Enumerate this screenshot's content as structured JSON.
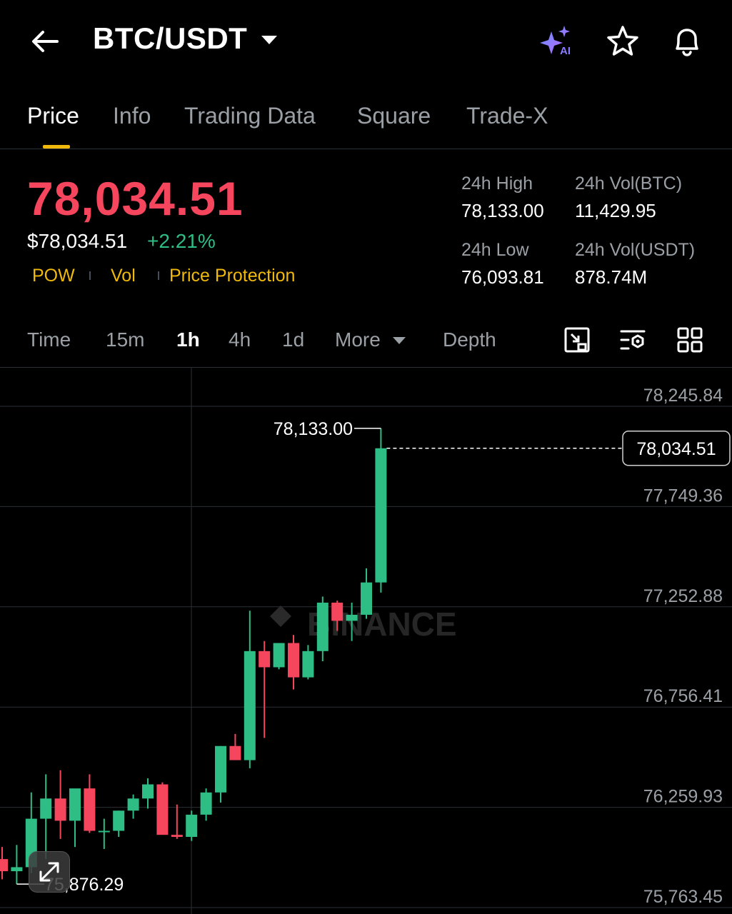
{
  "header": {
    "pair": "BTC/USDT",
    "icons": [
      "back-arrow-icon",
      "ai-sparkle-icon",
      "star-icon",
      "bell-icon"
    ],
    "ai_label": "AI"
  },
  "tabs": [
    {
      "label": "Price",
      "active": true
    },
    {
      "label": "Info"
    },
    {
      "label": "Trading Data"
    },
    {
      "label": "Square"
    },
    {
      "label": "Trade-X"
    }
  ],
  "price": {
    "last": "78,034.51",
    "usd": "$78,034.51",
    "change": "+2.21%",
    "tags": [
      "POW",
      "Vol",
      "Price Protection"
    ]
  },
  "stats": {
    "high_label": "24h High",
    "high_value": "78,133.00",
    "volbtc_label": "24h Vol(BTC)",
    "volbtc_value": "11,429.95",
    "low_label": "24h Low",
    "low_value": "76,093.81",
    "volusdt_label": "24h Vol(USDT)",
    "volusdt_value": "878.74M"
  },
  "intervals": {
    "items": [
      "Time",
      "15m",
      "1h",
      "4h",
      "1d",
      "More",
      "Depth"
    ],
    "active": "1h"
  },
  "chart_data": {
    "type": "candlestick",
    "watermark": "BINANCE",
    "y_ticks": [
      "78,245.84",
      "77,749.36",
      "77,252.88",
      "76,756.41",
      "76,259.93",
      "75,763.45"
    ],
    "y_tick_values": [
      78245.84,
      77749.36,
      77252.88,
      76756.41,
      76259.93,
      75763.45
    ],
    "ylim": [
      75763.45,
      78245.84
    ],
    "current_price": 78034.51,
    "current_label": "78,034.51",
    "high_marker": {
      "value": 78133.0,
      "label": "78,133.00"
    },
    "low_marker": {
      "value": 75876.29,
      "label": "75,876.29"
    },
    "candles": [
      {
        "o": 76000,
        "h": 76060,
        "l": 75900,
        "c": 75940
      },
      {
        "o": 75940,
        "h": 76070,
        "l": 75876.29,
        "c": 75960
      },
      {
        "o": 75960,
        "h": 76330,
        "l": 75930,
        "c": 76200
      },
      {
        "o": 76200,
        "h": 76420,
        "l": 76000,
        "c": 76300
      },
      {
        "o": 76300,
        "h": 76440,
        "l": 76100,
        "c": 76190
      },
      {
        "o": 76190,
        "h": 76340,
        "l": 76060,
        "c": 76350
      },
      {
        "o": 76350,
        "h": 76420,
        "l": 76130,
        "c": 76140
      },
      {
        "o": 76140,
        "h": 76200,
        "l": 76050,
        "c": 76140
      },
      {
        "o": 76140,
        "h": 76240,
        "l": 76110,
        "c": 76240
      },
      {
        "o": 76240,
        "h": 76320,
        "l": 76200,
        "c": 76300
      },
      {
        "o": 76300,
        "h": 76400,
        "l": 76250,
        "c": 76370
      },
      {
        "o": 76370,
        "h": 76380,
        "l": 76130,
        "c": 76120
      },
      {
        "o": 76120,
        "h": 76270,
        "l": 76100,
        "c": 76110
      },
      {
        "o": 76110,
        "h": 76240,
        "l": 76090,
        "c": 76220
      },
      {
        "o": 76220,
        "h": 76350,
        "l": 76190,
        "c": 76330
      },
      {
        "o": 76330,
        "h": 76560,
        "l": 76280,
        "c": 76560
      },
      {
        "o": 76560,
        "h": 76620,
        "l": 76510,
        "c": 76490
      },
      {
        "o": 76490,
        "h": 77230,
        "l": 76450,
        "c": 77030
      },
      {
        "o": 77030,
        "h": 77080,
        "l": 76600,
        "c": 76950
      },
      {
        "o": 76950,
        "h": 77070,
        "l": 76940,
        "c": 77070
      },
      {
        "o": 77070,
        "h": 77110,
        "l": 76840,
        "c": 76900
      },
      {
        "o": 76900,
        "h": 77060,
        "l": 76890,
        "c": 77030
      },
      {
        "o": 77030,
        "h": 77300,
        "l": 76980,
        "c": 77270
      },
      {
        "o": 77270,
        "h": 77280,
        "l": 77130,
        "c": 77180
      },
      {
        "o": 77180,
        "h": 77270,
        "l": 77080,
        "c": 77210
      },
      {
        "o": 77210,
        "h": 77440,
        "l": 77190,
        "c": 77370
      },
      {
        "o": 77370,
        "h": 78133.0,
        "l": 77320,
        "c": 78034.51
      }
    ]
  }
}
